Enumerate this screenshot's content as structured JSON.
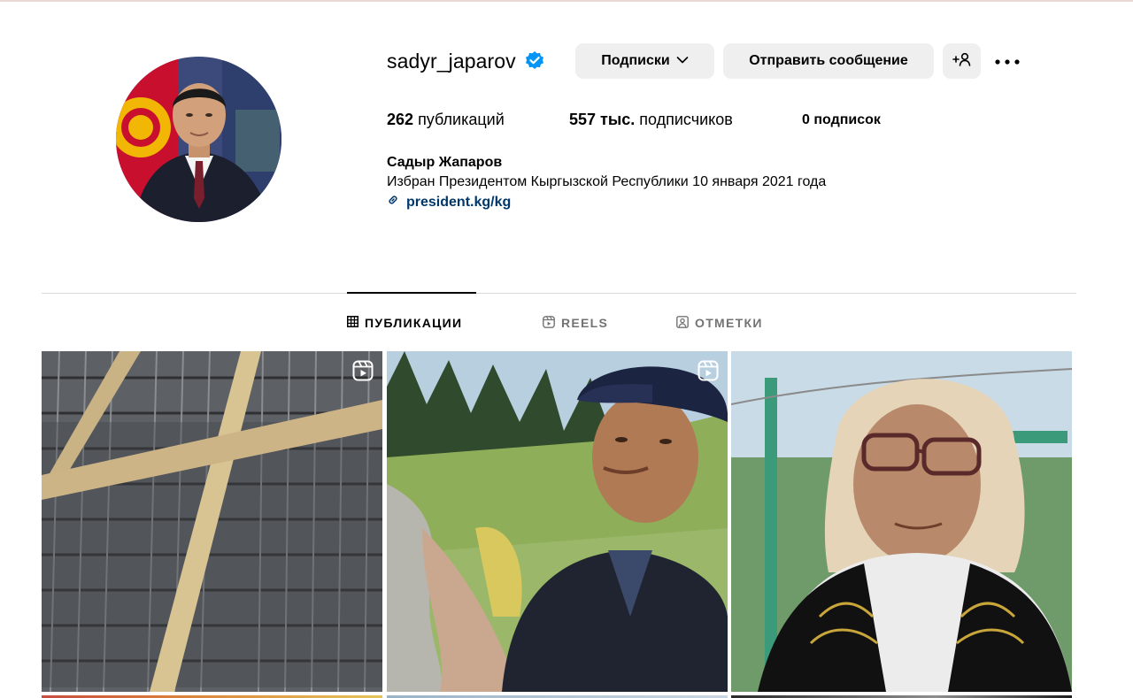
{
  "profile": {
    "username": "sadyr_japarov",
    "verified": true,
    "follow_label": "Подписки",
    "message_label": "Отправить сообщение",
    "suggest_label": "+",
    "stats": {
      "posts_value": "262",
      "posts_label": "публикаций",
      "followers_value": "557 тыс.",
      "followers_label": "подписчиков",
      "following_value": "0",
      "following_label": "подписок"
    },
    "full_name": "Садыр Жапаров",
    "bio": "Избран Президентом Кыргызской Республики 10 января 2021 года",
    "link": "president.kg/kg"
  },
  "tabs": [
    {
      "label": "ПУБЛИКАЦИИ",
      "icon": "grid-icon",
      "active": true
    },
    {
      "label": "REELS",
      "icon": "reels-icon",
      "active": false
    },
    {
      "label": "ОТМЕТКИ",
      "icon": "tagged-icon",
      "active": false
    }
  ],
  "posts": [
    {
      "type": "reel",
      "subject": "rebar construction"
    },
    {
      "type": "reel",
      "subject": "man in mountains"
    },
    {
      "type": "photo",
      "subject": "elderly woman"
    }
  ],
  "colors": {
    "verified": "#0095f6",
    "link": "#00376b",
    "button_bg": "#efefef",
    "muted": "#737373"
  }
}
